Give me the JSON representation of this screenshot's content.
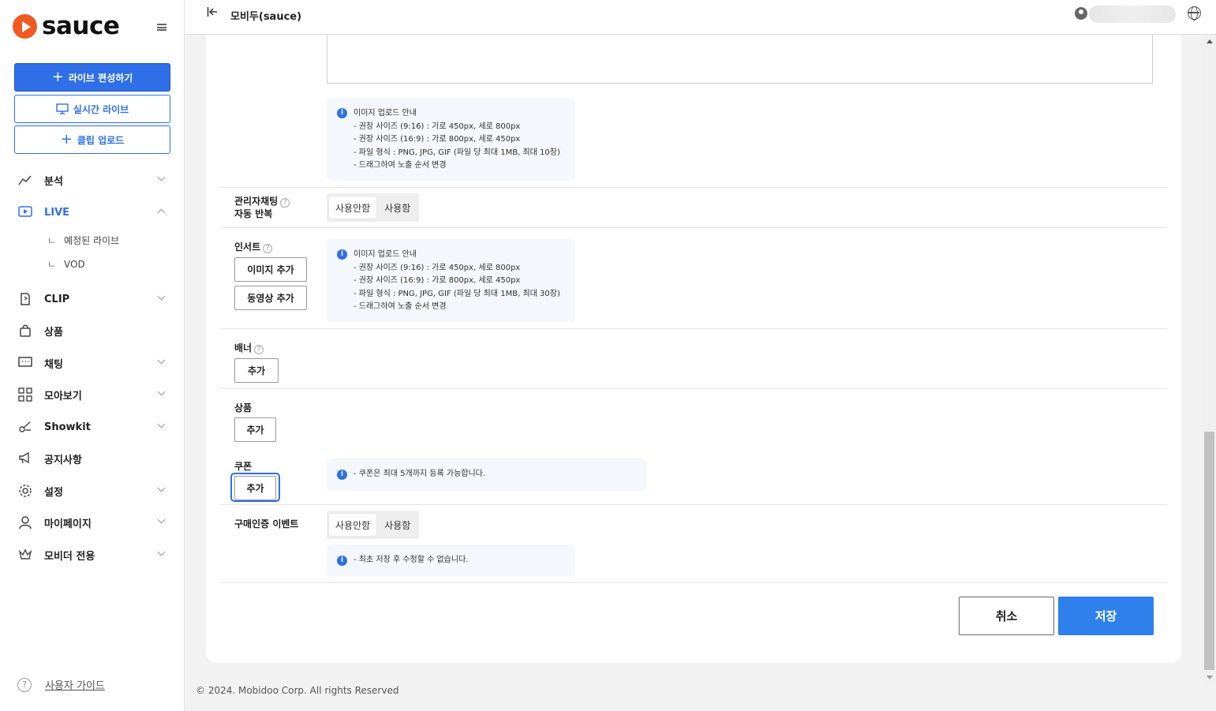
{
  "brand": {
    "name": "sauce",
    "color": "#f05a22"
  },
  "sidebar": {
    "create_live": "라이브 편성하기",
    "realtime_live": "실시간 라이브",
    "clip_upload": "클립 업로드",
    "items": [
      {
        "label": "분석",
        "icon": "analytics-icon"
      },
      {
        "label": "LIVE",
        "icon": "live-play-icon"
      },
      {
        "label": "CLIP",
        "icon": "clip-icon"
      },
      {
        "label": "상품",
        "icon": "shopping-bag-icon"
      },
      {
        "label": "채팅",
        "icon": "chat-icon"
      },
      {
        "label": "모아보기",
        "icon": "grid-icon"
      },
      {
        "label": "Showkit",
        "icon": "showkit-icon"
      },
      {
        "label": "공지사항",
        "icon": "megaphone-icon"
      },
      {
        "label": "설정",
        "icon": "gear-icon"
      },
      {
        "label": "마이페이지",
        "icon": "person-icon"
      },
      {
        "label": "모비더 전용",
        "icon": "crown-icon"
      }
    ],
    "live_sub": [
      {
        "prefix": "ㄴ",
        "label": "예정된 라이브"
      },
      {
        "prefix": "ㄴ",
        "label": "VOD"
      }
    ],
    "guide": "사용자 가이드"
  },
  "header": {
    "title": "모비두(sauce)"
  },
  "form": {
    "image_info": {
      "title": "이미지 업로드 안내",
      "lines": [
        "- 권장 사이즈 (9:16) : 가로 450px, 세로 800px",
        "- 권장 사이즈 (16:9) : 가로 800px, 세로 450px",
        "- 파일 형식 : PNG, JPG, GIF (파일 당 최대 1MB, 최대 10장)",
        "- 드래그하여 노출 순서 변경"
      ]
    },
    "admin_chat": {
      "label_line1": "관리자채팅",
      "label_line2": "자동 반복",
      "options": [
        "사용안함",
        "사용함"
      ],
      "selected": "사용안함"
    },
    "insert": {
      "label": "인서트",
      "add_image": "이미지 추가",
      "add_video": "동영상 추가",
      "info_title": "이미지 업로드 안내",
      "info_lines": [
        "- 권장 사이즈 (9:16) : 가로 450px, 세로 800px",
        "- 권장 사이즈 (16:9) : 가로 800px, 세로 450px",
        "- 파일 형식 : PNG, JPG, GIF (파일 당 최대 1MB, 최대 30장)",
        "- 드래그하여 노출 순서 변경"
      ]
    },
    "banner": {
      "label": "배너",
      "add": "추가"
    },
    "product": {
      "label": "상품",
      "add": "추가"
    },
    "coupon": {
      "label": "쿠폰",
      "add": "추가",
      "info": "- 쿠폰은 최대 5개까지 등록 가능합니다."
    },
    "purchase_event": {
      "label": "구매인증 이벤트",
      "options": [
        "사용안함",
        "사용함"
      ],
      "selected": "사용안함",
      "info": "- 최초 저장 후 수정할 수 없습니다."
    },
    "help_glyph": "?",
    "info_glyph": "i",
    "cancel": "취소",
    "save": "저장"
  },
  "footer": {
    "copyright": "© 2024. Mobidoo Corp. All rights Reserved"
  },
  "colors": {
    "primary": "#2f6fe8",
    "save": "#2f80ed"
  }
}
